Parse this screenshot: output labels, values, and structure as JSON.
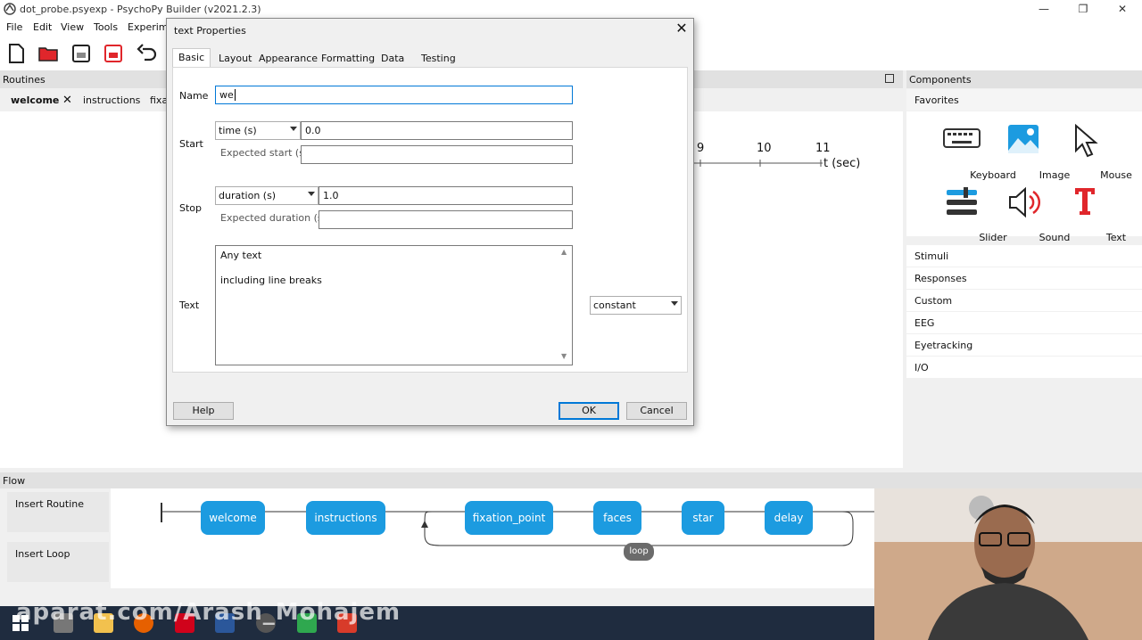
{
  "window": {
    "title": "dot_probe.psyexp - PsychoPy Builder (v2021.2.3)"
  },
  "menu": [
    "File",
    "Edit",
    "View",
    "Tools",
    "Experime"
  ],
  "routines": {
    "header": "Routines",
    "tabs": [
      "welcome",
      "instructions",
      "fixa"
    ],
    "timeline": {
      "ticks": [
        "9",
        "10",
        "11"
      ],
      "axis_label": "t (sec)"
    }
  },
  "components": {
    "header": "Components",
    "favorites_label": "Favorites",
    "favorites": [
      {
        "label": "Keyboard",
        "icon": "keyboard-icon"
      },
      {
        "label": "Image",
        "icon": "image-icon"
      },
      {
        "label": "Mouse",
        "icon": "mouse-icon"
      },
      {
        "label": "Slider",
        "icon": "slider-icon"
      },
      {
        "label": "Sound",
        "icon": "sound-icon"
      },
      {
        "label": "Text",
        "icon": "text-icon"
      }
    ],
    "categories": [
      "Stimuli",
      "Responses",
      "Custom",
      "EEG",
      "Eyetracking",
      "I/O"
    ]
  },
  "flow": {
    "header": "Flow",
    "insert_routine": "Insert Routine",
    "insert_loop": "Insert Loop",
    "nodes": [
      "welcome",
      "instructions",
      "fixation_point",
      "faces",
      "star",
      "delay"
    ],
    "loop_label": "loop"
  },
  "dialog": {
    "title": "text Properties",
    "tabs": [
      "Basic",
      "Layout",
      "Appearance",
      "Formatting",
      "Data",
      "Testing"
    ],
    "active_tab": "Basic",
    "name_label": "Name",
    "name_value": "we",
    "start_label": "Start",
    "start_type": "time (s)",
    "start_value": "0.0",
    "expected_start_label": "Expected start (s)",
    "expected_start_value": "",
    "stop_label": "Stop",
    "stop_type": "duration (s)",
    "stop_value": "1.0",
    "expected_duration_label": "Expected duration (s)",
    "expected_duration_value": "",
    "text_label": "Text",
    "text_line1": "Any text",
    "text_line2": "including line breaks",
    "text_update": "constant",
    "help_label": "Help",
    "ok_label": "OK",
    "cancel_label": "Cancel"
  },
  "watermark": "aparat.com/Arash_Mohajem",
  "colors": {
    "flow_node": "#1c9be0",
    "text_icon": "#e0262b",
    "taskbar": "#1f2c3f"
  }
}
